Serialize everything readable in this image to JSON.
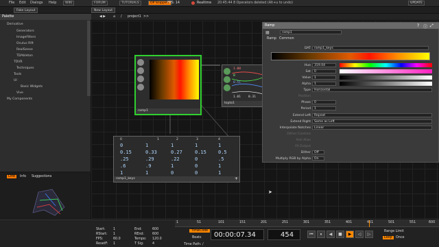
{
  "menubar": {
    "items": [
      "File",
      "Edit",
      "Dialogs",
      "Help"
    ],
    "buttons": [
      "WIKI",
      "FORUM",
      "TUTORIALS",
      "OP Snippets"
    ],
    "fps_label": "FPS: 14",
    "realtime": "Realtime",
    "status": "20:45:44 8 Operators deleted (Alt+u to undo)",
    "update": "UPDATE"
  },
  "tabs": [
    "Fake Layout",
    "New Layout"
  ],
  "path": {
    "root": "/",
    "project": "project1",
    "sub": ">>"
  },
  "palette": {
    "title": "Palette",
    "items": [
      "Derivative",
      "Generators",
      "ImageFilters",
      "Oculus Rift",
      "RealSense",
      "TDAbleton",
      "TDVR",
      "Techniques",
      "Tools",
      "UI",
      "Basic Widgets",
      "Vive",
      "My Components"
    ]
  },
  "nodes": {
    "ramp": "ramp1",
    "topto": "topto1",
    "table": "ramp1_keys"
  },
  "table": {
    "headers": [
      "0",
      "1",
      "2",
      "3",
      "4"
    ],
    "rows": [
      [
        "0",
        "1",
        "1",
        "1",
        "1"
      ],
      [
        "0.15",
        "0.33",
        "0.27",
        "0.15",
        "0.5"
      ],
      [
        ".25",
        ".29",
        ".22",
        "0",
        ".5"
      ],
      [
        ".6",
        ".9",
        "1",
        "0",
        "1"
      ],
      [
        "1",
        "1",
        "0",
        "0",
        "1"
      ]
    ]
  },
  "topto_rows": [
    "1.00",
    "0",
    "0.51",
    "1.01",
    "0.31"
  ],
  "params": {
    "title": "Ramp",
    "op_name": "ramp1",
    "tabs": [
      "Ramp",
      "Common"
    ],
    "dat_label": "DAT",
    "dat_value": "ramp1_keys",
    "rows": [
      {
        "label": "Hue",
        "value": "319.04"
      },
      {
        "label": "Sat",
        "value": "0"
      },
      {
        "label": "Value",
        "value": "1"
      },
      {
        "label": "Alpha",
        "value": "1"
      },
      {
        "label": "Type",
        "value": "Horizontal"
      },
      {
        "label": "Position",
        "value": ""
      },
      {
        "label": "Phase",
        "value": "0"
      },
      {
        "label": "Period",
        "value": "1"
      },
      {
        "label": "Extend Left",
        "value": "Repeat"
      },
      {
        "label": "Extend Right",
        "value": "Same as Left"
      },
      {
        "label": "Interpolate Notches",
        "value": "Linear"
      },
      {
        "label": "Dither Controls",
        "value": ""
      },
      {
        "label": "Anti Alias",
        "value": ""
      },
      {
        "label": "Fit Output",
        "value": ""
      },
      {
        "label": "Dither",
        "value": "Off"
      },
      {
        "label": "Multiply RGB by Alpha",
        "value": "On"
      }
    ]
  },
  "viewer": {
    "tabs": [
      "Line",
      "Info",
      "Suggestions"
    ]
  },
  "timeline": {
    "start": "1",
    "rstart": "1",
    "fps": "60.0",
    "resetf": "1",
    "end": "600",
    "rend": "600",
    "tempo": "120.0",
    "tsig": "4",
    "timecode": "00:00:07.34",
    "frame": "454",
    "timecode_btn": "TimeCode",
    "beats_btn": "Beats",
    "range_limit": "Range Limit",
    "loop": "Loop",
    "once": "Once",
    "ruler": [
      "1",
      "51",
      "101",
      "151",
      "201",
      "251",
      "301",
      "351",
      "401",
      "451",
      "501",
      "551",
      "600"
    ],
    "time_path": "Time Path: /"
  },
  "colors": {
    "accent": "#2fd12f",
    "timeline_orange": "#ff8800"
  }
}
